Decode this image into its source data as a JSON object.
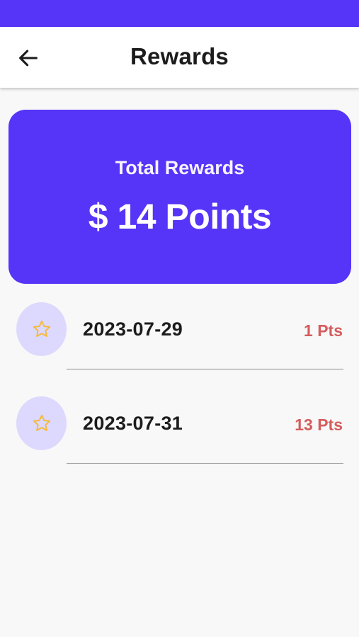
{
  "header": {
    "title": "Rewards",
    "back_icon": "arrow-left-icon"
  },
  "summary": {
    "label": "Total Rewards",
    "value": "$ 14 Points"
  },
  "rewards": [
    {
      "date": "2023-07-29",
      "points": "1 Pts",
      "icon": "star-icon"
    },
    {
      "date": "2023-07-31",
      "points": "13 Pts",
      "icon": "star-icon"
    }
  ],
  "colors": {
    "primary": "#5635f8",
    "icon_bg": "#ddd8fd",
    "star": "#f5b935",
    "points": "#d55c5c"
  }
}
